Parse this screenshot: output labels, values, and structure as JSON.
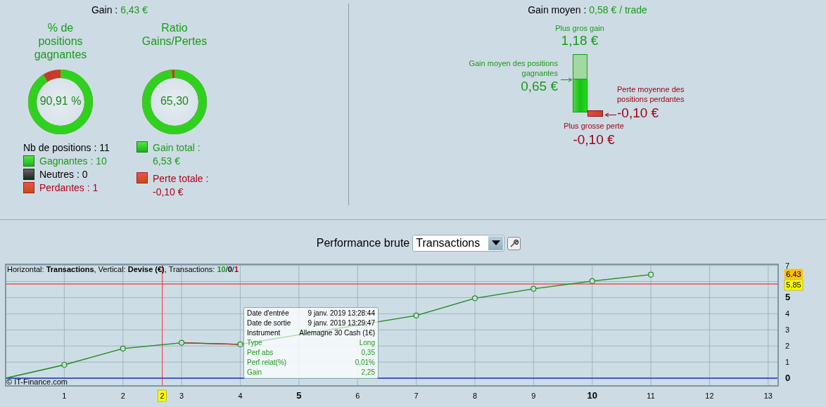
{
  "summary": {
    "title_label": "Gain :",
    "title_value": "6,43 €",
    "donuts": [
      {
        "title": "% de positions gagnantes",
        "value": "90,91 %",
        "level": 0.9091
      },
      {
        "title": "Ratio Gains/Pertes",
        "value": "65,30",
        "level": 0.985
      }
    ],
    "count_label": "Nb de positions : 11",
    "legend_counts": [
      {
        "label": "Gagnantes : 10",
        "kind": "gain"
      },
      {
        "label": "Neutres : 0",
        "kind": "neutral"
      },
      {
        "label": "Perdantes : 1",
        "kind": "loss"
      }
    ],
    "legend_totals": [
      {
        "label": "Gain total :",
        "value": "6,53 €",
        "kind": "gain"
      },
      {
        "label": "Perte totale :",
        "value": "-0,10 €",
        "kind": "loss"
      }
    ]
  },
  "average": {
    "title_label": "Gain moyen :",
    "title_value": "0,58 € / trade",
    "best_label": "Plus gros gain",
    "best_value": "1,18 €",
    "avg_win_label": "Gain moyen des positions gagnantes",
    "avg_win_value": "0,65 €",
    "avg_loss_label": "Perte moyenne des positions perdantes",
    "avg_loss_value": "-0,10 €",
    "worst_label": "Plus grosse perte",
    "worst_value": "-0,10 €"
  },
  "performance": {
    "label": "Performance brute",
    "mode": "Transactions",
    "caption": "Horizontal: **Transactions**, Vertical: **Devise (€)**, Transactions: ",
    "counts": [
      {
        "text": "10",
        "kind": "gain"
      },
      {
        "text": "0",
        "kind": "neutral"
      },
      {
        "text": "1",
        "kind": "loss"
      }
    ],
    "separator": "/",
    "copyright": "© IT-Finance.com",
    "tooltip": [
      {
        "label": "Date d'entrée",
        "value": "9 janv. 2019 13:28:44",
        "kind": "plain"
      },
      {
        "label": "Date de sortie",
        "value": "9 janv. 2019 13:29:47",
        "kind": "plain"
      },
      {
        "label": "Instrument",
        "value": "Allemagne 30 Cash (1€)",
        "kind": "plain"
      },
      {
        "label": "Type",
        "value": "Long",
        "kind": "gain"
      },
      {
        "label": "Perf abs",
        "value": "0,35",
        "kind": "gain"
      },
      {
        "label": "Perf relat(%)",
        "value": "0,01%",
        "kind": "gain"
      },
      {
        "label": "Gain",
        "value": "2,25",
        "kind": "gain"
      }
    ],
    "chart_data": {
      "type": "line",
      "x": [
        0,
        1,
        2,
        3,
        4,
        7,
        8,
        9,
        10,
        11
      ],
      "series": [
        {
          "color": "#228b22",
          "values": [
            0,
            0.83,
            1.84,
            2.2,
            2.1,
            3.89,
            4.96,
            5.55,
            6.03,
            6.43
          ]
        }
      ],
      "xlim": [
        0,
        13.17
      ],
      "ylim": [
        -0.48,
        7.07
      ],
      "grid": true,
      "marker": "circle",
      "xticks": [
        1,
        2,
        3,
        4,
        5,
        6,
        7,
        8,
        9,
        10,
        11,
        12,
        13
      ],
      "yticks": [
        0,
        1,
        2,
        3,
        4,
        5,
        7
      ],
      "ref_lines": [
        {
          "axis": "x",
          "value": 2.67,
          "color": "#ee5050"
        },
        {
          "axis": "y",
          "value": 5.85,
          "label": "5,85",
          "color": "#ee5050"
        },
        {
          "axis": "y",
          "value": 0,
          "color": "#2030d0"
        }
      ],
      "annotations": [
        "6.43"
      ]
    },
    "cursor_label": "2"
  }
}
